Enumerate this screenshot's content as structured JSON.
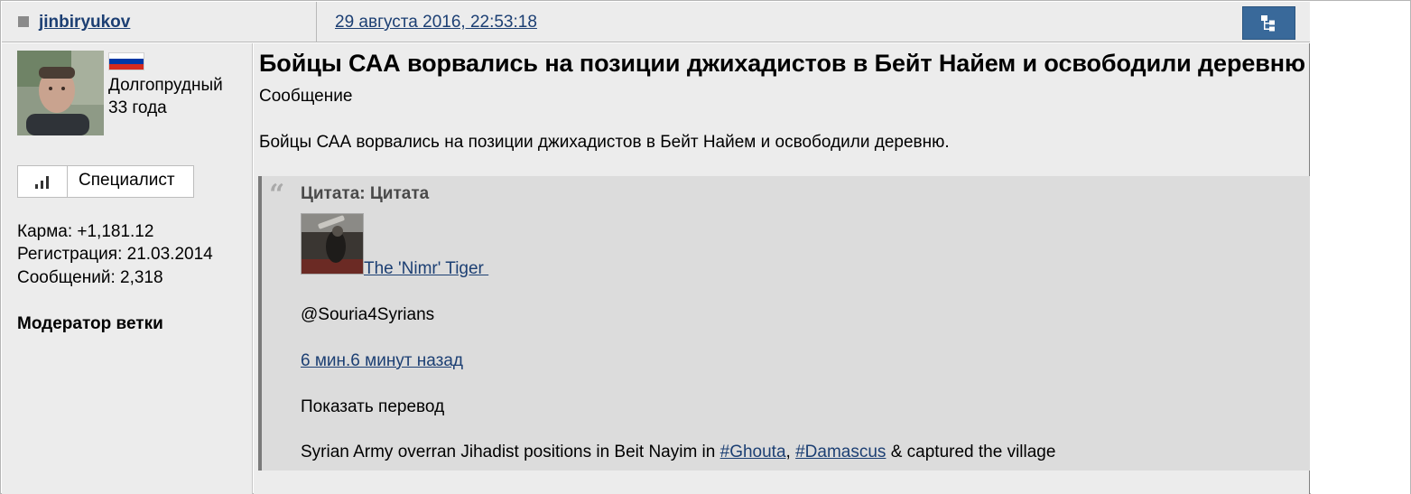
{
  "header": {
    "username": "jinbiryukov",
    "date": "29 августа 2016, 22:53:18",
    "tree_icon": "tree-structure-icon"
  },
  "author": {
    "avatar_icon": "user-photo",
    "flag": "russia-flag",
    "flag_colors": [
      "#ffffff",
      "#0039a6",
      "#d52b1e"
    ],
    "city": "Долгопрудный",
    "age": "33 года",
    "rank_icon": "signal-bars-icon",
    "rank": "Специалист",
    "karma": "Карма: +1,181.12",
    "registration": "Регистрация: 21.03.2014",
    "messages": "Сообщений: 2,318",
    "role": "Модератор ветки"
  },
  "post": {
    "title": "Бойцы САА ворвались на позиции джихадистов в Бейт Найем и освободили деревню",
    "label": "Сообщение",
    "body": "Бойцы САА ворвались на позиции джихадистов в Бейт Найем и освободили деревню."
  },
  "quote": {
    "mark": "“",
    "title": "Цитата: Цитата",
    "tweet": {
      "author_name": "The 'Nimr' Tiger ",
      "handle": "@Souria4Syrians",
      "time": "6 мин.6 минут назад",
      "translate": "Показать перевод",
      "text_before": "Syrian Army overran Jihadist positions in Beit Nayim in ",
      "hashtag1": "#Ghouta",
      "separator": ", ",
      "hashtag2": "#Damascus",
      "text_after": " & captured the village"
    }
  },
  "colors": {
    "link": "#1c3f73",
    "header_bg": "#ececec",
    "quote_bg": "#dcdcdc",
    "button_bg": "#39699a"
  }
}
